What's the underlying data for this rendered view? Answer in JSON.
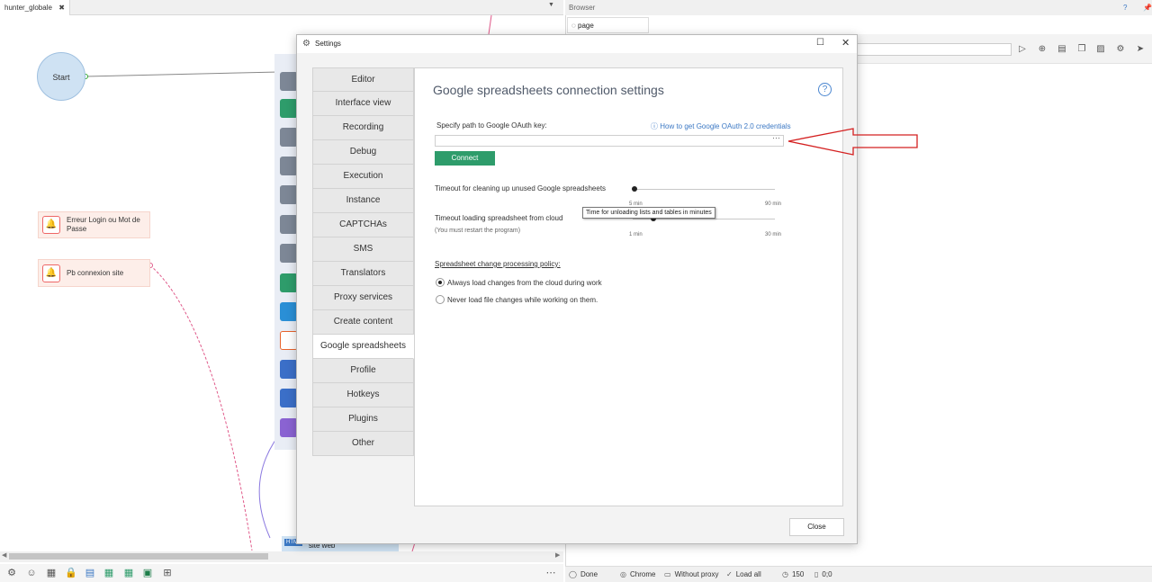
{
  "workspace": {
    "project_tab": "hunter_globale",
    "start_node": "Start",
    "error_nodes": [
      "Erreur Login ou Mot de Passe",
      "Pb connexion site"
    ],
    "site_node_badge": "HTML",
    "site_node_label": "site web"
  },
  "browser": {
    "header": "Browser",
    "help": "?",
    "tab": "page"
  },
  "statusbar": {
    "done": "Done",
    "chrome": "Chrome",
    "proxy": "Without proxy",
    "load": "Load all",
    "count": "150",
    "coords": "0;0"
  },
  "dialog": {
    "title": "Settings",
    "nav": [
      "Editor",
      "Interface view",
      "Recording",
      "Debug",
      "Execution",
      "Instance",
      "CAPTCHAs",
      "SMS",
      "Translators",
      "Proxy services",
      "Create content",
      "Google spreadsheets",
      "Profile",
      "Hotkeys",
      "Plugins",
      "Other"
    ],
    "active_nav": "Google spreadsheets",
    "heading": "Google spreadsheets connection settings",
    "oauth_label": "Specify path to Google OAuth key:",
    "oauth_link": "How to get Google OAuth 2.0 credentials",
    "oauth_value": "",
    "oauth_browse": "···",
    "connect": "Connect",
    "timeout_cleanup_label": "Timeout for cleaning up unused Google spreadsheets",
    "timeout_cleanup_min": "5 min",
    "timeout_cleanup_max": "90 min",
    "timeout_cleanup_value": 5,
    "timeout_loading_label": "Timeout loading spreadsheet from cloud",
    "timeout_loading_note": "(You must restart the program)",
    "timeout_loading_min": "1 min",
    "timeout_loading_max": "30 min",
    "timeout_loading_value": 3,
    "tooltip": "Time for unloading lists and tables in minutes",
    "policy_label": "Spreadsheet change processing policy:",
    "policy_options": [
      "Always load changes from the cloud during work",
      "Never load file changes while working on them."
    ],
    "policy_selected": 0,
    "close": "Close"
  }
}
